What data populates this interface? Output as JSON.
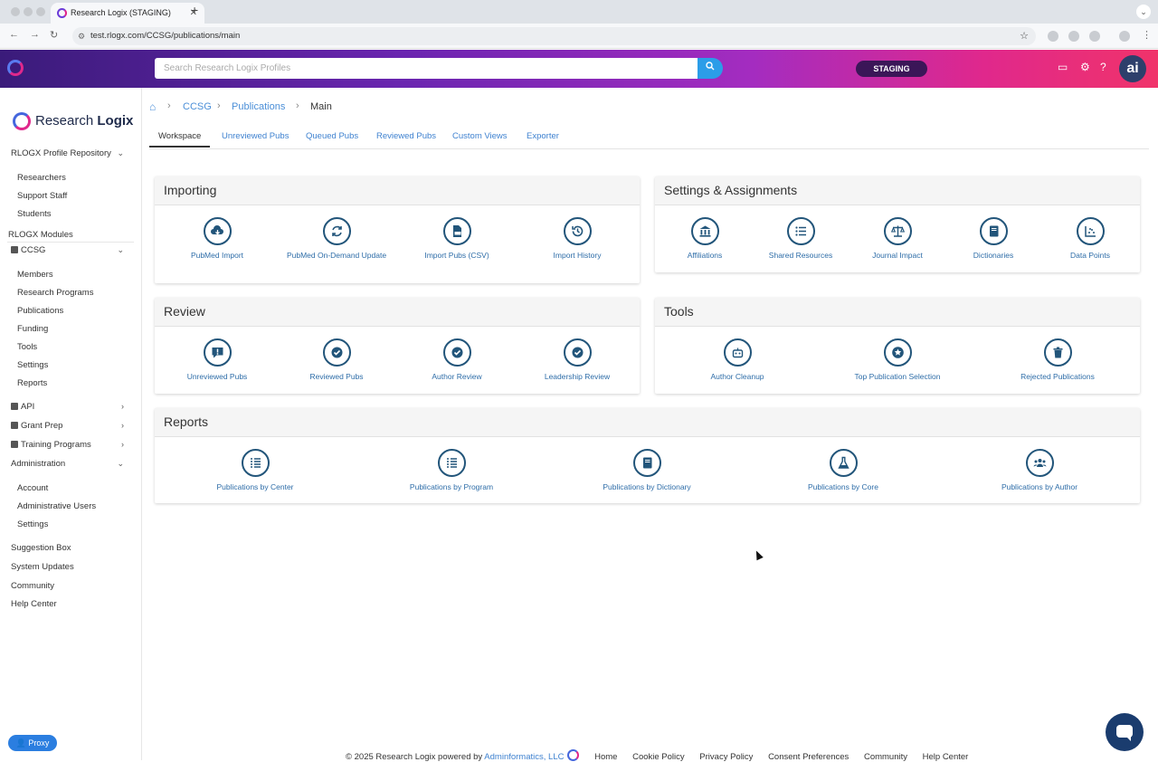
{
  "browser": {
    "tab_title": "Research Logix (STAGING)",
    "new_tab": "+",
    "url": "test.rlogx.com/CCSG/publications/main"
  },
  "header": {
    "search_placeholder": "Search Research Logix Profiles",
    "env_badge": "STAGING",
    "avatar": "ai"
  },
  "sidebar": {
    "brand_prefix": "Research ",
    "brand_bold": "Logix",
    "profile_repo": "RLOGX Profile Repository",
    "repo_items": [
      "Researchers",
      "Support Staff",
      "Students"
    ],
    "modules_label": "RLOGX Modules",
    "ccsg": "CCSG",
    "ccsg_items": [
      "Members",
      "Research Programs",
      "Publications",
      "Funding",
      "Tools",
      "Settings",
      "Reports"
    ],
    "api": "API",
    "grant_prep": "Grant Prep",
    "training": "Training Programs",
    "administration": "Administration",
    "admin_items": [
      "Account",
      "Administrative Users",
      "Settings"
    ],
    "bottom_items": [
      "Suggestion Box",
      "System Updates",
      "Community",
      "Help Center"
    ],
    "proxy": "Proxy"
  },
  "breadcrumb": {
    "l1": "CCSG",
    "l2": "Publications",
    "current": "Main"
  },
  "tabs": [
    "Workspace",
    "Unreviewed Pubs",
    "Queued Pubs",
    "Reviewed Pubs",
    "Custom Views",
    "Exporter"
  ],
  "cards": {
    "importing": {
      "title": "Importing",
      "tiles": [
        "PubMed Import",
        "PubMed On-Demand Update",
        "Import Pubs (CSV)",
        "Import History"
      ]
    },
    "settings": {
      "title": "Settings & Assignments",
      "tiles": [
        "Affiliations",
        "Shared Resources",
        "Journal Impact",
        "Dictionaries",
        "Data Points"
      ]
    },
    "review": {
      "title": "Review",
      "tiles": [
        "Unreviewed Pubs",
        "Reviewed Pubs",
        "Author Review",
        "Leadership Review"
      ]
    },
    "tools": {
      "title": "Tools",
      "tiles": [
        "Author Cleanup",
        "Top Publication Selection",
        "Rejected Publications"
      ]
    },
    "reports": {
      "title": "Reports",
      "tiles": [
        "Publications by Center",
        "Publications by Program",
        "Publications by Dictionary",
        "Publications by Core",
        "Publications by Author"
      ]
    }
  },
  "footer": {
    "copyright": "© 2025 Research Logix powered by ",
    "company": "Adminformatics, LLC",
    "links": [
      "Home",
      "Cookie Policy",
      "Privacy Policy",
      "Consent Preferences",
      "Community",
      "Help Center"
    ]
  },
  "colors": {
    "accent": "#2e6da8",
    "icon_ring": "#22557a",
    "header_gradient_start": "#3a1b7a",
    "header_gradient_end": "#f0336a",
    "staging_badge": "#3b1658"
  }
}
